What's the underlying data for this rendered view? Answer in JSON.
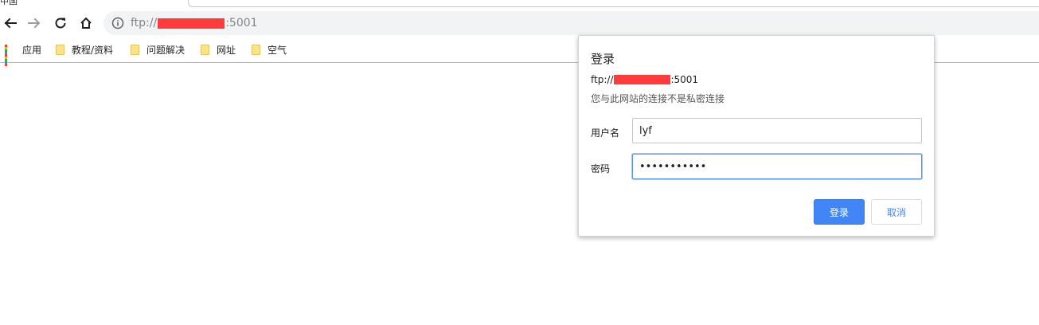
{
  "tab": {
    "partial_title": "中国"
  },
  "toolbar": {
    "url_prefix": "ftp://",
    "url_suffix": ":5001"
  },
  "bookmarks": [
    {
      "label": "应用",
      "icon": "apps-icon"
    },
    {
      "label": "教程/资料",
      "icon": "folder-icon"
    },
    {
      "label": "问题解决",
      "icon": "folder-icon"
    },
    {
      "label": "网址",
      "icon": "folder-icon"
    },
    {
      "label": "空气",
      "icon": "folder-icon"
    }
  ],
  "dialog": {
    "title": "登录",
    "url_prefix": "ftp://",
    "url_suffix": ":5001",
    "warning": "您与此网站的连接不是私密连接",
    "username_label": "用户名",
    "username_value": "lyf",
    "password_label": "密码",
    "password_value": "•••••••••••",
    "login_button": "登录",
    "cancel_button": "取消"
  },
  "colors": {
    "accent": "#4285f4",
    "redaction": "#ff3b3b",
    "folder": "#fce38a",
    "omnibox_bg": "#f1f3f4"
  }
}
